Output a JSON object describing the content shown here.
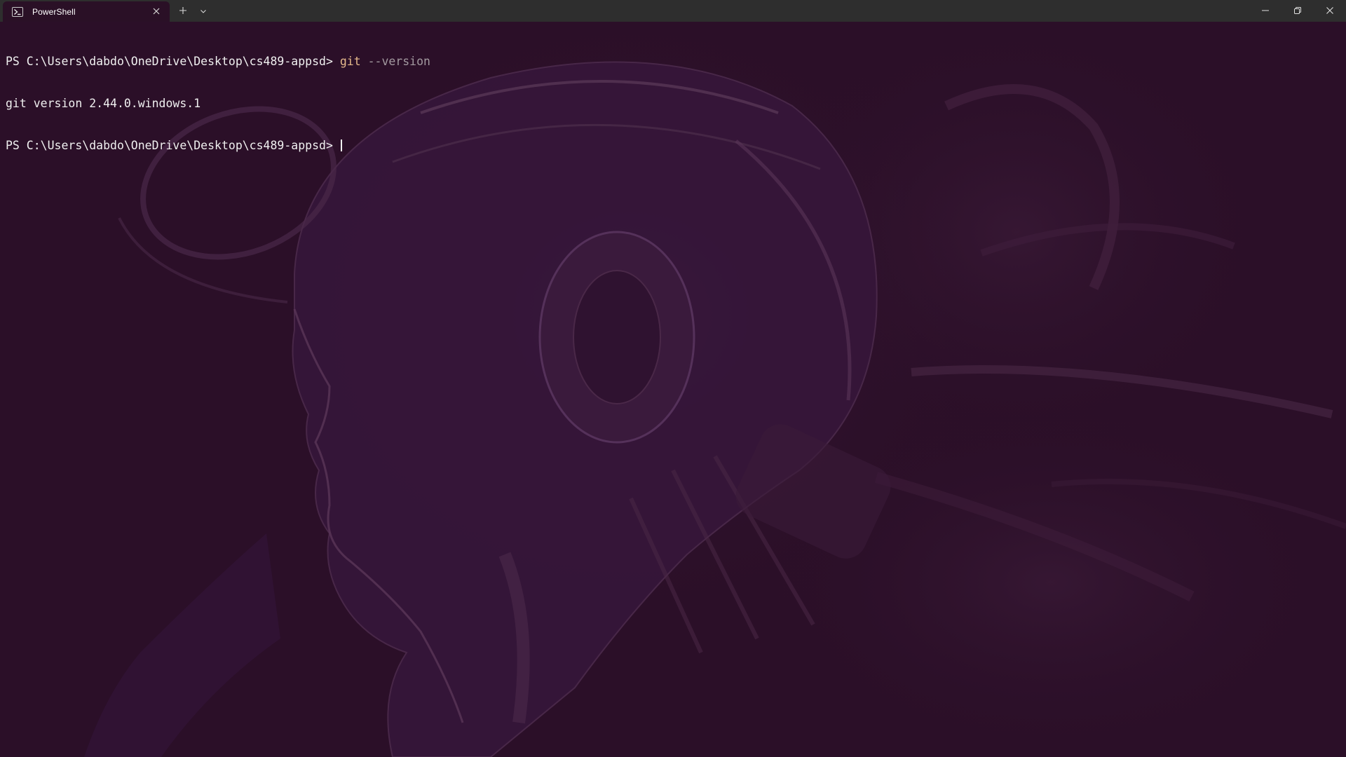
{
  "window": {
    "tab_title": "PowerShell",
    "tab_icon": "powershell-icon",
    "new_tab_icon": "plus-icon",
    "dropdown_icon": "chevron-down-icon",
    "controls": [
      "minimize-icon",
      "restore-icon",
      "close-icon"
    ]
  },
  "terminal": {
    "lines": [
      {
        "prompt": "PS C:\\Users\\dabdo\\OneDrive\\Desktop\\cs489-appsd> ",
        "command": "git",
        "args": " --version"
      },
      {
        "output": "git version 2.44.0.windows.1"
      },
      {
        "prompt": "PS C:\\Users\\dabdo\\OneDrive\\Desktop\\cs489-appsd> ",
        "command": "",
        "args": ""
      }
    ],
    "background_image": "cyborg-head-artwork"
  },
  "colors": {
    "background": "#2b0f28",
    "titlebar": "#2e2e2e",
    "command": "#e6b98c",
    "args": "#a39aa0",
    "text": "#f0f0f0"
  }
}
